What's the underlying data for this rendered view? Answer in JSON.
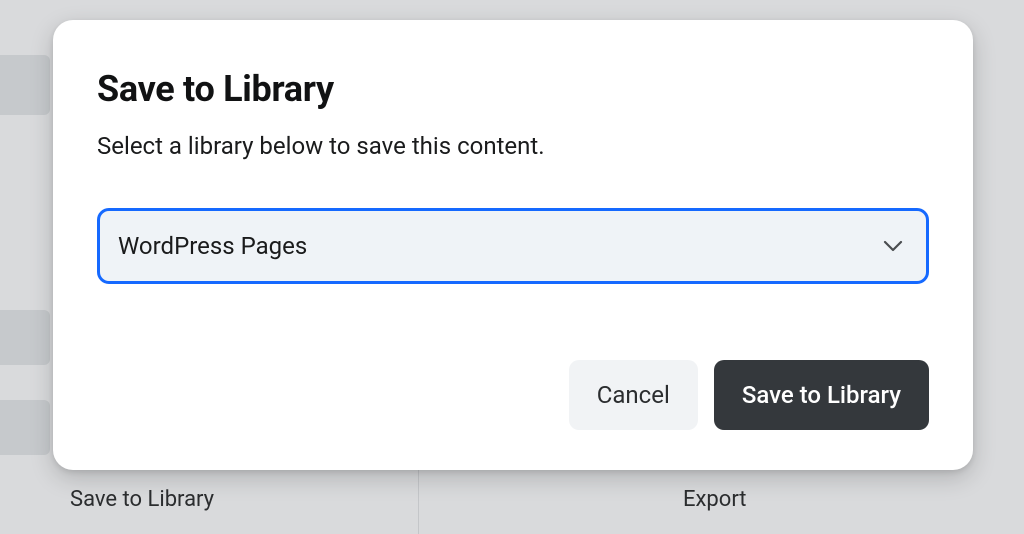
{
  "modal": {
    "title": "Save to Library",
    "subtitle": "Select a library below to save this content.",
    "select": {
      "selected": "WordPress Pages"
    },
    "actions": {
      "cancel": "Cancel",
      "save": "Save to Library"
    }
  },
  "background": {
    "bottom_left": "Save to Library",
    "bottom_right": "Export"
  }
}
